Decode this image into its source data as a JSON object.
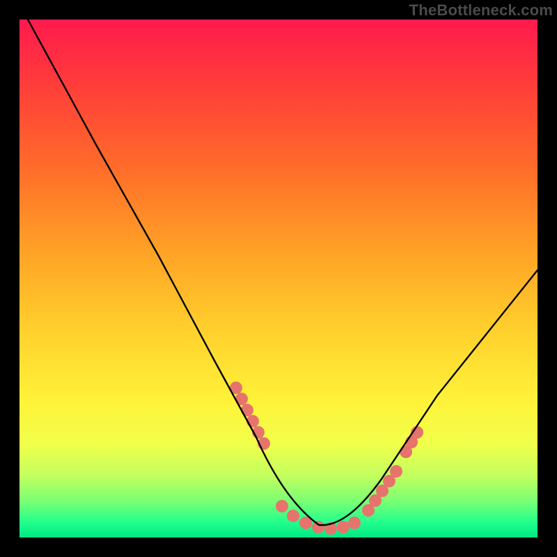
{
  "watermark": "TheBottleneck.com",
  "chart_data": {
    "type": "line",
    "title": "",
    "xlabel": "",
    "ylabel": "",
    "xlim": [
      0,
      100
    ],
    "ylim": [
      0,
      100
    ],
    "grid": false,
    "legend": false,
    "x": [
      2,
      6,
      10,
      14,
      18,
      22,
      26,
      30,
      34,
      38,
      42,
      46,
      50,
      52,
      54,
      56,
      58,
      60,
      62,
      64,
      66,
      70,
      74,
      78,
      82,
      86,
      90,
      94,
      98,
      100
    ],
    "y": [
      100,
      93,
      86,
      79,
      72,
      64,
      57,
      50,
      43,
      36,
      29,
      22,
      14,
      10,
      6,
      4,
      2,
      1,
      1,
      2,
      4,
      8,
      13,
      19,
      25,
      31,
      37,
      43,
      49,
      52
    ],
    "markers": {
      "color": "#e6746c",
      "shape": "rounded-rect",
      "segments": [
        {
          "x_start": 41,
          "x_end": 46,
          "y_start": 28,
          "y_end": 19
        },
        {
          "x_start": 50,
          "x_end": 63,
          "y_start": 7,
          "y_end": 2
        },
        {
          "x_start": 66,
          "x_end": 72,
          "y_start": 6,
          "y_end": 13
        },
        {
          "x_start": 72,
          "x_end": 75,
          "y_start": 13,
          "y_end": 20
        }
      ]
    },
    "background_gradient": {
      "stops": [
        {
          "pos": 0.0,
          "color": "#ff1a4d"
        },
        {
          "pos": 0.12,
          "color": "#ff3b3b"
        },
        {
          "pos": 0.28,
          "color": "#ff6a2a"
        },
        {
          "pos": 0.45,
          "color": "#ffa326"
        },
        {
          "pos": 0.6,
          "color": "#ffd02c"
        },
        {
          "pos": 0.74,
          "color": "#fff33a"
        },
        {
          "pos": 0.82,
          "color": "#f0ff4a"
        },
        {
          "pos": 0.88,
          "color": "#c3ff5e"
        },
        {
          "pos": 0.93,
          "color": "#7aff73"
        },
        {
          "pos": 0.97,
          "color": "#23ff8c"
        },
        {
          "pos": 1.0,
          "color": "#00e884"
        }
      ]
    }
  }
}
